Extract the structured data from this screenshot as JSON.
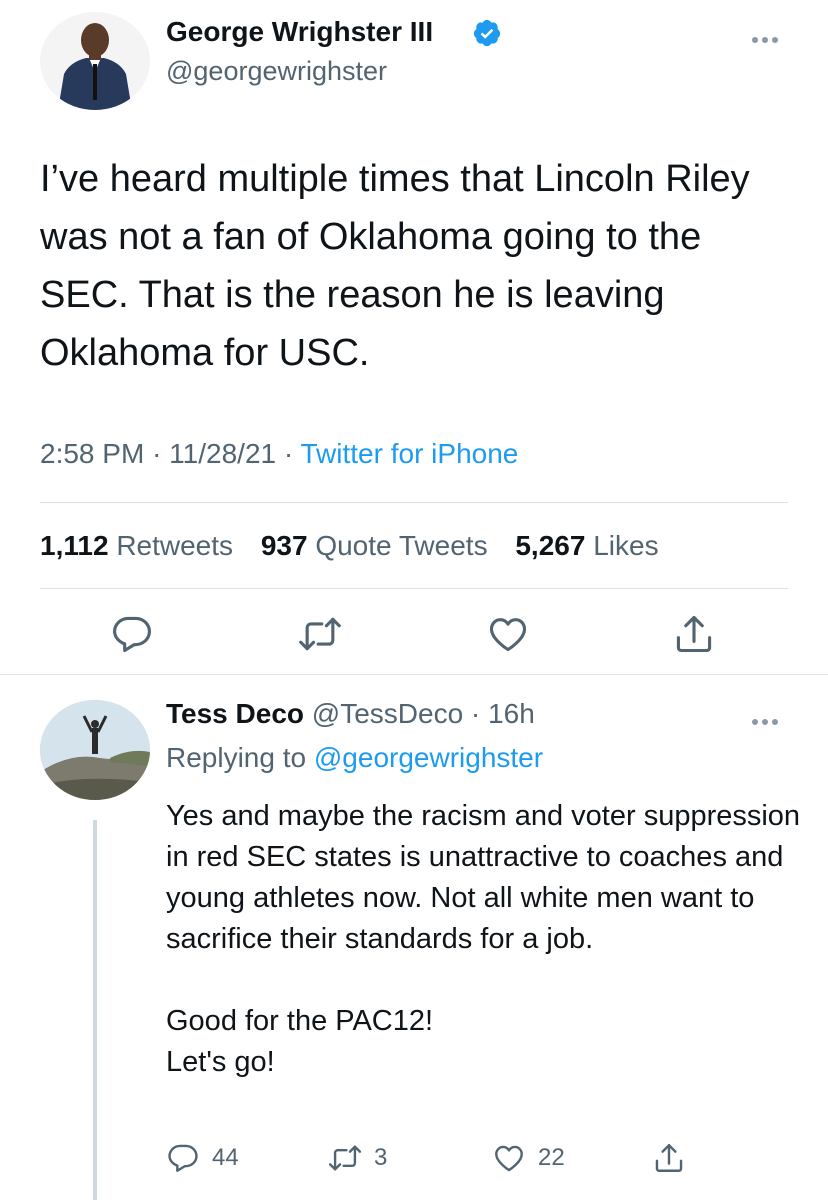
{
  "tweet": {
    "author_name": "George Wrighster III",
    "author_handle": "@georgewrighster",
    "text": "I’ve heard multiple times that Lincoln Riley was not a fan of Oklahoma going to the SEC. That is the reason he is leaving Oklahoma for USC.",
    "time": "2:58 PM",
    "date": "11/28/21",
    "source": "Twitter for iPhone",
    "retweets_count": "1,112",
    "retweets_label": "Retweets",
    "quotes_count": "937",
    "quotes_label": "Quote Tweets",
    "likes_count": "5,267",
    "likes_label": "Likes"
  },
  "reply": {
    "author_name": "Tess Deco",
    "author_handle": "@TessDeco",
    "age": "16h",
    "replying_prefix": "Replying to",
    "replying_handle": "@georgewrighster",
    "paragraph1": "Yes and maybe the racism and voter suppression in red SEC states is unattractive to coaches and young athletes now. Not all white men want to sacrifice their standards for a job.",
    "paragraph2_line1": "Good for the PAC12!",
    "paragraph2_line2": "Let's go!",
    "reply_count": "44",
    "retweet_count": "3",
    "like_count": "22"
  },
  "icons": [
    "verified-badge-icon",
    "more-icon",
    "reply-icon",
    "retweet-icon",
    "like-icon",
    "share-icon"
  ],
  "colors": {
    "accent": "#1d9bf0",
    "secondary_text": "#536471",
    "primary_text": "#0f1419"
  }
}
